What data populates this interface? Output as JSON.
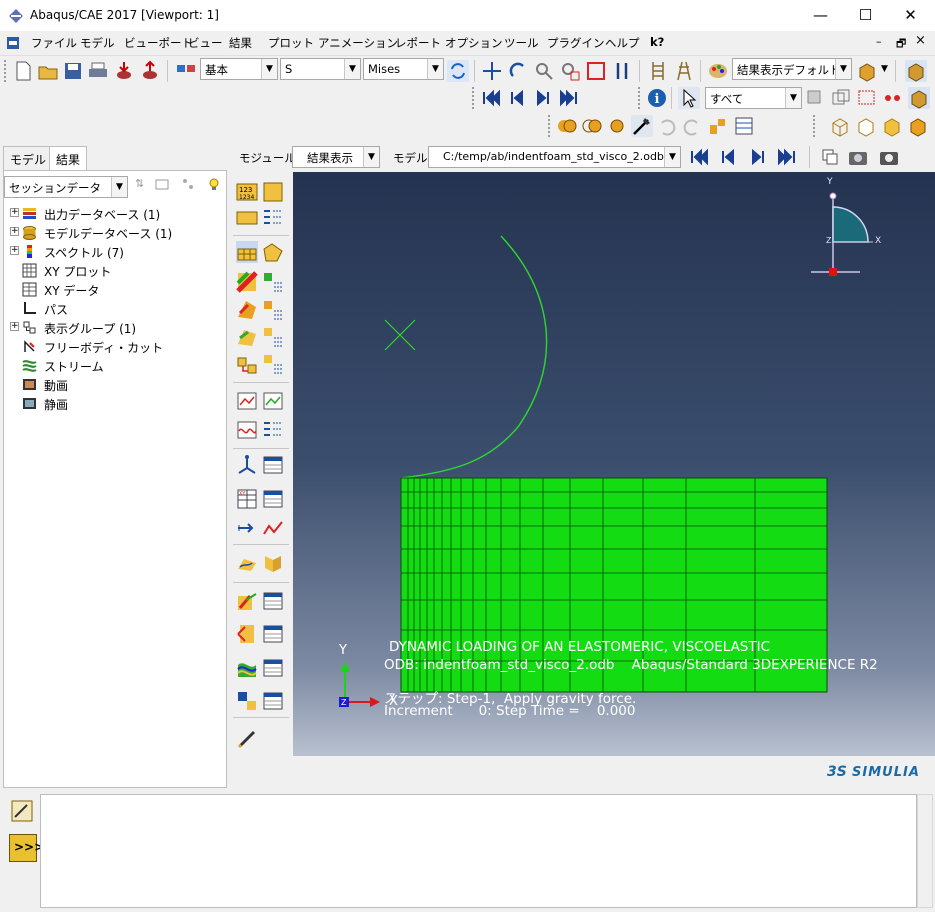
{
  "window": {
    "title": "Abaqus/CAE 2017 [Viewport: 1]",
    "controls": {
      "minimize": "—",
      "maximize": "☐",
      "close": "✕"
    }
  },
  "menubar": {
    "items": [
      "ファイル",
      "モデル",
      "ビューポート",
      "ビュー",
      "結果",
      "プロット",
      "アニメーション",
      "レポート",
      "オプション",
      "ツール",
      "プラグイン",
      "ヘルプ",
      "k?"
    ],
    "doc_controls": {
      "minimize": "–",
      "restore": "🗗",
      "close": "×"
    }
  },
  "toolbar1": {
    "display_group": "基本",
    "variable": "S",
    "invariant": "Mises",
    "plot_state": "結果表示デフォルト"
  },
  "toolbar2": {
    "selection_filter": "すべて"
  },
  "context_bar": {
    "module_label": "モジュール:",
    "module_value": "結果表示",
    "model_label": "モデル:",
    "model_value": "C:/temp/ab/indentfoam_std_visco_2.odb"
  },
  "left_panel": {
    "tabs": [
      "モデル",
      "結果"
    ],
    "active_tab": "結果",
    "session_dropdown": "セッションデータ",
    "tree": [
      {
        "label": "出力データベース (1)",
        "expandable": true,
        "icon": "odb-icon"
      },
      {
        "label": "モデルデータベース (1)",
        "expandable": true,
        "icon": "mdb-icon"
      },
      {
        "label": "スペクトル (7)",
        "expandable": true,
        "icon": "spectrum-icon"
      },
      {
        "label": "XY プロット",
        "expandable": false,
        "icon": "xy-plot-icon"
      },
      {
        "label": "XY データ",
        "expandable": false,
        "icon": "xy-data-icon"
      },
      {
        "label": "パス",
        "expandable": false,
        "icon": "path-icon"
      },
      {
        "label": "表示グループ (1)",
        "expandable": true,
        "icon": "display-group-icon"
      },
      {
        "label": "フリーボディ・カット",
        "expandable": false,
        "icon": "free-body-icon"
      },
      {
        "label": "ストリーム",
        "expandable": false,
        "icon": "stream-icon"
      },
      {
        "label": "動画",
        "expandable": false,
        "icon": "movie-icon"
      },
      {
        "label": "静画",
        "expandable": false,
        "icon": "image-icon"
      }
    ]
  },
  "viewport": {
    "title_block": {
      "line1": "DYNAMIC LOADING OF AN ELASTOMERIC, VISCOELASTIC",
      "line2": "ODB: indentfoam_std_visco_2.odb    Abaqus/Standard 3DEXPERIENCE R2"
    },
    "state_block": {
      "line1": "ステップ: Step-1,  Apply gravity force.",
      "line2": "Increment      0: Step Time =    0.000"
    },
    "triad": {
      "y": "Y",
      "x": "X",
      "z": "Z"
    },
    "view_triad": {
      "y": "Y",
      "x": "X",
      "z": "Z"
    },
    "colors": {
      "mesh": "#13dc13",
      "edges": "#0a4a0a",
      "indenter": "#2ed82e"
    }
  },
  "brand": {
    "name": "SIMULIA",
    "mark": "3S"
  },
  "message_area": {
    "text": ""
  },
  "colors": {
    "accent": "#0078d7",
    "panel": "#f0f0f0"
  }
}
